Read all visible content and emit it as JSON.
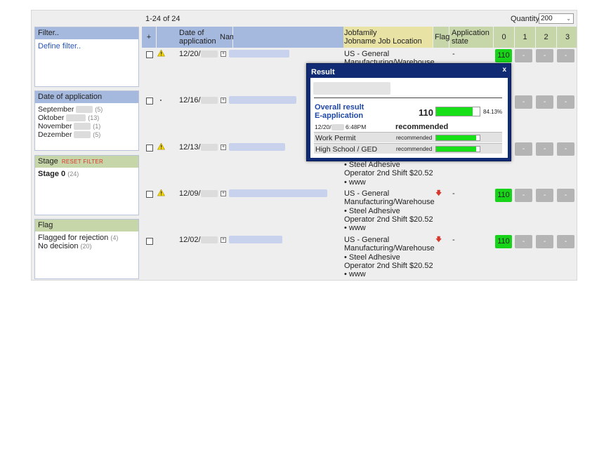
{
  "list": {
    "count_text": "1-24 of 24",
    "quantity_label": "Quantity",
    "quantity_value": "200"
  },
  "sidebar": {
    "filter": {
      "title": "Filter..",
      "define_link": "Define filter.."
    },
    "date_of_application": {
      "title": "Date of application",
      "items": [
        {
          "label": "September",
          "count": "(5)"
        },
        {
          "label": "Oktober",
          "count": "(13)"
        },
        {
          "label": "November",
          "count": "(1)"
        },
        {
          "label": "Dezember",
          "count": "(5)"
        }
      ]
    },
    "stage": {
      "title": "Stage",
      "reset": "Reset filter",
      "item_label": "Stage 0",
      "item_count": "(24)"
    },
    "flag": {
      "title": "Flag",
      "items": [
        {
          "label": "Flagged for rejection",
          "count": "(4)"
        },
        {
          "label": "No decision",
          "count": "(20)"
        }
      ]
    }
  },
  "table": {
    "headers": {
      "select_all": "+",
      "date": "Date of application",
      "name": "Name",
      "jobfamily": "Jobfamily",
      "jobname": "Jobname Job Location",
      "flag": "Flag",
      "state": "Application state",
      "col0": "0",
      "col1": "1",
      "col2": "2",
      "col3": "3"
    },
    "rows": [
      {
        "date": "12/20/",
        "job_l1": "US - General",
        "job_l2": "Manufacturing/Warehouse",
        "job_l3": "",
        "job_l4": "",
        "job_l5": "",
        "state": "-",
        "score": "110",
        "c1": "-",
        "c2": "-",
        "c3": "-"
      },
      {
        "date": "12/16/",
        "job_l1": "",
        "job_l2": "",
        "job_l3": "",
        "job_l4": "",
        "job_l5": "",
        "state": "",
        "score": "",
        "c1": "-",
        "c2": "-",
        "c3": "-"
      },
      {
        "date": "12/13/",
        "job_l1": "",
        "job_l2": "",
        "job_l3": "• Steel Adhesive",
        "job_l4": "Operator 2nd Shift $20.52",
        "job_l5": "• www",
        "state": "",
        "score": "",
        "c1": "-",
        "c2": "-",
        "c3": "-"
      },
      {
        "date": "12/09/",
        "job_l1": "US - General",
        "job_l2": "Manufacturing/Warehouse",
        "job_l3": "• Steel Adhesive",
        "job_l4": "Operator 2nd Shift $20.52",
        "job_l5": "• www",
        "state": "-",
        "score": "110",
        "c1": "-",
        "c2": "-",
        "c3": "-"
      },
      {
        "date": "12/02/",
        "job_l1": "US - General",
        "job_l2": "Manufacturing/Warehouse",
        "job_l3": "• Steel Adhesive",
        "job_l4": "Operator 2nd Shift $20.52",
        "job_l5": "• www",
        "state": "-",
        "score": "110",
        "c1": "-",
        "c2": "-",
        "c3": "-"
      }
    ]
  },
  "result_popup": {
    "title": "Result",
    "close": "x",
    "overall_l1": "Overall result",
    "overall_l2": "E-application",
    "score": "110",
    "percent": "84.13%",
    "percent_fraction": 0.8413,
    "time": "6:48PM",
    "date_prefix": "12/20/",
    "recommendation": "recommended",
    "criteria": [
      {
        "label": "Work Permit",
        "status": "recommended",
        "fraction": 0.92
      },
      {
        "label": "High School / GED",
        "status": "recommended",
        "fraction": 0.92
      }
    ]
  },
  "colors": {
    "header_blue": "#a5b8de",
    "header_yellow": "#e8e2a4",
    "header_green": "#c7d6a8",
    "score_green": "#18d418",
    "popup_navy": "#102b73",
    "link_blue": "#2a55b5",
    "reset_red": "#d9362b"
  },
  "icons": [
    "warning-icon",
    "paperclip-icon",
    "expand-plus-icon",
    "flag-down-arrow-icon",
    "chevron-down-icon",
    "close-icon"
  ]
}
